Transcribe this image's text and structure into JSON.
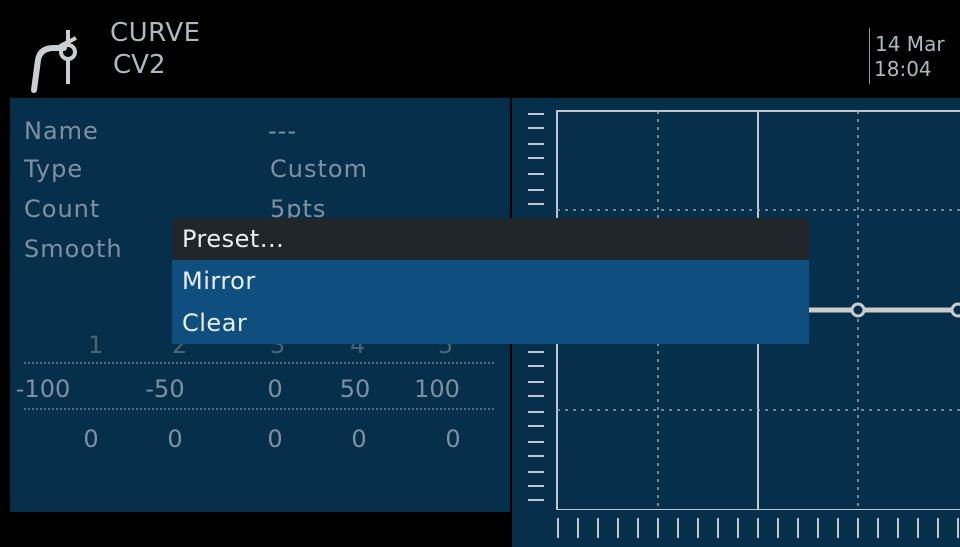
{
  "header": {
    "icon": "curve-icon",
    "title": "CURVE",
    "subtitle": "CV2",
    "date": "14 Mar",
    "time": "18:04"
  },
  "properties": [
    {
      "label": "Name",
      "value": "---"
    },
    {
      "label": "Type",
      "value": "Custom"
    },
    {
      "label": "Count",
      "value": "5pts"
    },
    {
      "label": "Smooth",
      "value": ""
    }
  ],
  "points": {
    "numbers": [
      "1",
      "2",
      "3",
      "4",
      "5"
    ],
    "x": [
      "-100",
      "-50",
      "0",
      "50",
      "100"
    ],
    "y": [
      "0",
      "0",
      "0",
      "0",
      "0"
    ]
  },
  "menu": {
    "items": [
      "Preset...",
      "Mirror",
      "Clear"
    ]
  },
  "colors": {
    "panel": "#062f4b",
    "menu_highlight": "#0f4f80",
    "menu_header": "#21262b",
    "curve": "#c9cdcc"
  }
}
